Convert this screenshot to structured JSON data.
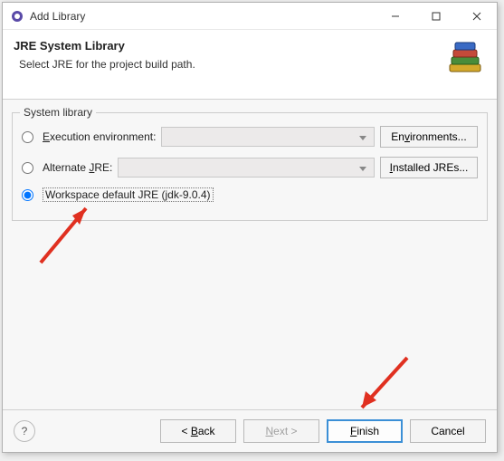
{
  "titlebar": {
    "title": "Add Library"
  },
  "header": {
    "title": "JRE System Library",
    "description": "Select JRE for the project build path."
  },
  "group": {
    "label": "System library",
    "options": {
      "exec_env": {
        "label_pre": "E",
        "label_post": "xecution environment:"
      },
      "alternate": {
        "label_pre": "Alternate ",
        "label_u": "J",
        "label_post": "RE:"
      },
      "workspace": {
        "label": "Workspace default JRE (jdk-9.0.4)"
      }
    },
    "buttons": {
      "environments": "Environments...",
      "installed": "Installed JREs..."
    }
  },
  "footer": {
    "back": "< Back",
    "next": "Next >",
    "finish": "Finish",
    "cancel": "Cancel"
  }
}
